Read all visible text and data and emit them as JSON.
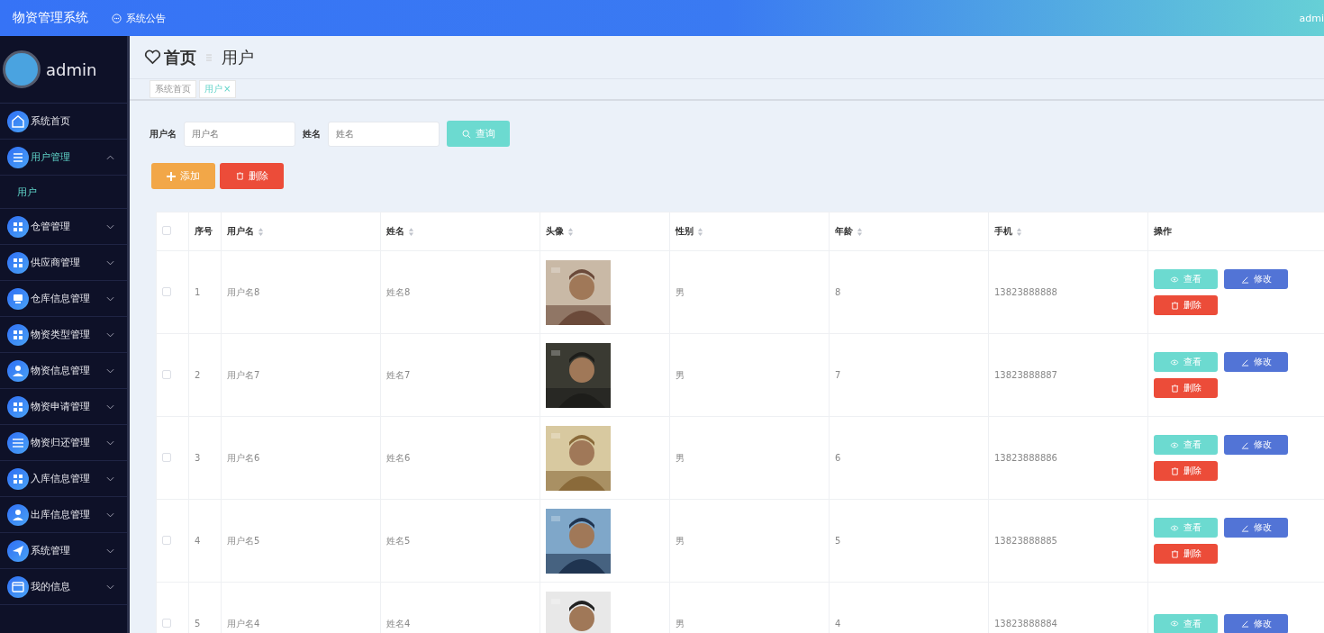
{
  "header": {
    "title": "物资管理系统",
    "notice": "系统公告",
    "user": "admi"
  },
  "sidebar": {
    "user": "admin",
    "items": [
      {
        "label": "系统首页",
        "selected": false
      },
      {
        "label": "用户管理",
        "expanded": true,
        "selected": true,
        "children": [
          {
            "label": "用户",
            "selected": true
          }
        ]
      },
      {
        "label": "仓管管理",
        "expanded": false,
        "selected": false
      },
      {
        "label": "供应商管理",
        "expanded": false,
        "selected": false
      },
      {
        "label": "仓库信息管理",
        "expanded": false,
        "selected": false
      },
      {
        "label": "物资类型管理",
        "expanded": false,
        "selected": false
      },
      {
        "label": "物资信息管理",
        "expanded": false,
        "selected": false
      },
      {
        "label": "物资申请管理",
        "expanded": false,
        "selected": false
      },
      {
        "label": "物资归还管理",
        "expanded": false,
        "selected": false
      },
      {
        "label": "入库信息管理",
        "expanded": false,
        "selected": false
      },
      {
        "label": "出库信息管理",
        "expanded": false,
        "selected": false
      },
      {
        "label": "系统管理",
        "expanded": false,
        "selected": false
      },
      {
        "label": "我的信息",
        "expanded": false,
        "selected": false
      }
    ]
  },
  "breadcrumb": {
    "home": "首页",
    "current": "用户"
  },
  "tabs": [
    {
      "label": "系统首页",
      "selected": false,
      "closable": false
    },
    {
      "label": "用户",
      "selected": true,
      "closable": true,
      "close": "×"
    }
  ],
  "search": {
    "fields": [
      {
        "label": "用户名",
        "placeholder": "用户名"
      },
      {
        "label": "姓名",
        "placeholder": "姓名"
      }
    ],
    "button": "查询"
  },
  "actions": {
    "add": "添加",
    "delete": "删除"
  },
  "table": {
    "select_all": {
      "checked": false
    },
    "columns": [
      {
        "label": "序号",
        "sortable": false
      },
      {
        "label": "用户名",
        "sortable": true
      },
      {
        "label": "姓名",
        "sortable": true
      },
      {
        "label": "头像",
        "sortable": true
      },
      {
        "label": "性别",
        "sortable": true
      },
      {
        "label": "年龄",
        "sortable": true
      },
      {
        "label": "手机",
        "sortable": true
      },
      {
        "label": "操作",
        "sortable": false
      }
    ],
    "rows": [
      {
        "checked": false,
        "index": "1",
        "username": "用户名8",
        "name": "姓名8",
        "gender": "男",
        "age": "8",
        "phone": "13823888888",
        "actions": {
          "view": "查看",
          "edit": "修改",
          "delete": "删除"
        }
      },
      {
        "checked": false,
        "index": "2",
        "username": "用户名7",
        "name": "姓名7",
        "gender": "男",
        "age": "7",
        "phone": "13823888887",
        "actions": {
          "view": "查看",
          "edit": "修改",
          "delete": "删除"
        }
      },
      {
        "checked": false,
        "index": "3",
        "username": "用户名6",
        "name": "姓名6",
        "gender": "男",
        "age": "6",
        "phone": "13823888886",
        "actions": {
          "view": "查看",
          "edit": "修改",
          "delete": "删除"
        }
      },
      {
        "checked": false,
        "index": "4",
        "username": "用户名5",
        "name": "姓名5",
        "gender": "男",
        "age": "5",
        "phone": "13823888885",
        "actions": {
          "view": "查看",
          "edit": "修改",
          "delete": "删除"
        }
      },
      {
        "checked": false,
        "index": "5",
        "username": "用户名4",
        "name": "姓名4",
        "gender": "男",
        "age": "4",
        "phone": "13823888884",
        "actions": {
          "view": "查看",
          "edit": "修改"
        }
      }
    ]
  }
}
